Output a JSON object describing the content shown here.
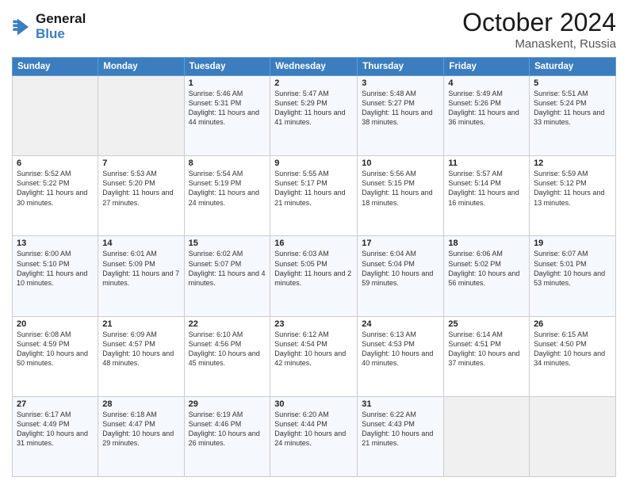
{
  "header": {
    "logo_line1": "General",
    "logo_line2": "Blue",
    "month": "October 2024",
    "location": "Manaskent, Russia"
  },
  "days_of_week": [
    "Sunday",
    "Monday",
    "Tuesday",
    "Wednesday",
    "Thursday",
    "Friday",
    "Saturday"
  ],
  "weeks": [
    [
      {
        "num": "",
        "info": ""
      },
      {
        "num": "",
        "info": ""
      },
      {
        "num": "1",
        "info": "Sunrise: 5:46 AM\nSunset: 5:31 PM\nDaylight: 11 hours and 44 minutes."
      },
      {
        "num": "2",
        "info": "Sunrise: 5:47 AM\nSunset: 5:29 PM\nDaylight: 11 hours and 41 minutes."
      },
      {
        "num": "3",
        "info": "Sunrise: 5:48 AM\nSunset: 5:27 PM\nDaylight: 11 hours and 38 minutes."
      },
      {
        "num": "4",
        "info": "Sunrise: 5:49 AM\nSunset: 5:26 PM\nDaylight: 11 hours and 36 minutes."
      },
      {
        "num": "5",
        "info": "Sunrise: 5:51 AM\nSunset: 5:24 PM\nDaylight: 11 hours and 33 minutes."
      }
    ],
    [
      {
        "num": "6",
        "info": "Sunrise: 5:52 AM\nSunset: 5:22 PM\nDaylight: 11 hours and 30 minutes."
      },
      {
        "num": "7",
        "info": "Sunrise: 5:53 AM\nSunset: 5:20 PM\nDaylight: 11 hours and 27 minutes."
      },
      {
        "num": "8",
        "info": "Sunrise: 5:54 AM\nSunset: 5:19 PM\nDaylight: 11 hours and 24 minutes."
      },
      {
        "num": "9",
        "info": "Sunrise: 5:55 AM\nSunset: 5:17 PM\nDaylight: 11 hours and 21 minutes."
      },
      {
        "num": "10",
        "info": "Sunrise: 5:56 AM\nSunset: 5:15 PM\nDaylight: 11 hours and 18 minutes."
      },
      {
        "num": "11",
        "info": "Sunrise: 5:57 AM\nSunset: 5:14 PM\nDaylight: 11 hours and 16 minutes."
      },
      {
        "num": "12",
        "info": "Sunrise: 5:59 AM\nSunset: 5:12 PM\nDaylight: 11 hours and 13 minutes."
      }
    ],
    [
      {
        "num": "13",
        "info": "Sunrise: 6:00 AM\nSunset: 5:10 PM\nDaylight: 11 hours and 10 minutes."
      },
      {
        "num": "14",
        "info": "Sunrise: 6:01 AM\nSunset: 5:09 PM\nDaylight: 11 hours and 7 minutes."
      },
      {
        "num": "15",
        "info": "Sunrise: 6:02 AM\nSunset: 5:07 PM\nDaylight: 11 hours and 4 minutes."
      },
      {
        "num": "16",
        "info": "Sunrise: 6:03 AM\nSunset: 5:05 PM\nDaylight: 11 hours and 2 minutes."
      },
      {
        "num": "17",
        "info": "Sunrise: 6:04 AM\nSunset: 5:04 PM\nDaylight: 10 hours and 59 minutes."
      },
      {
        "num": "18",
        "info": "Sunrise: 6:06 AM\nSunset: 5:02 PM\nDaylight: 10 hours and 56 minutes."
      },
      {
        "num": "19",
        "info": "Sunrise: 6:07 AM\nSunset: 5:01 PM\nDaylight: 10 hours and 53 minutes."
      }
    ],
    [
      {
        "num": "20",
        "info": "Sunrise: 6:08 AM\nSunset: 4:59 PM\nDaylight: 10 hours and 50 minutes."
      },
      {
        "num": "21",
        "info": "Sunrise: 6:09 AM\nSunset: 4:57 PM\nDaylight: 10 hours and 48 minutes."
      },
      {
        "num": "22",
        "info": "Sunrise: 6:10 AM\nSunset: 4:56 PM\nDaylight: 10 hours and 45 minutes."
      },
      {
        "num": "23",
        "info": "Sunrise: 6:12 AM\nSunset: 4:54 PM\nDaylight: 10 hours and 42 minutes."
      },
      {
        "num": "24",
        "info": "Sunrise: 6:13 AM\nSunset: 4:53 PM\nDaylight: 10 hours and 40 minutes."
      },
      {
        "num": "25",
        "info": "Sunrise: 6:14 AM\nSunset: 4:51 PM\nDaylight: 10 hours and 37 minutes."
      },
      {
        "num": "26",
        "info": "Sunrise: 6:15 AM\nSunset: 4:50 PM\nDaylight: 10 hours and 34 minutes."
      }
    ],
    [
      {
        "num": "27",
        "info": "Sunrise: 6:17 AM\nSunset: 4:49 PM\nDaylight: 10 hours and 31 minutes."
      },
      {
        "num": "28",
        "info": "Sunrise: 6:18 AM\nSunset: 4:47 PM\nDaylight: 10 hours and 29 minutes."
      },
      {
        "num": "29",
        "info": "Sunrise: 6:19 AM\nSunset: 4:46 PM\nDaylight: 10 hours and 26 minutes."
      },
      {
        "num": "30",
        "info": "Sunrise: 6:20 AM\nSunset: 4:44 PM\nDaylight: 10 hours and 24 minutes."
      },
      {
        "num": "31",
        "info": "Sunrise: 6:22 AM\nSunset: 4:43 PM\nDaylight: 10 hours and 21 minutes."
      },
      {
        "num": "",
        "info": ""
      },
      {
        "num": "",
        "info": ""
      }
    ]
  ]
}
